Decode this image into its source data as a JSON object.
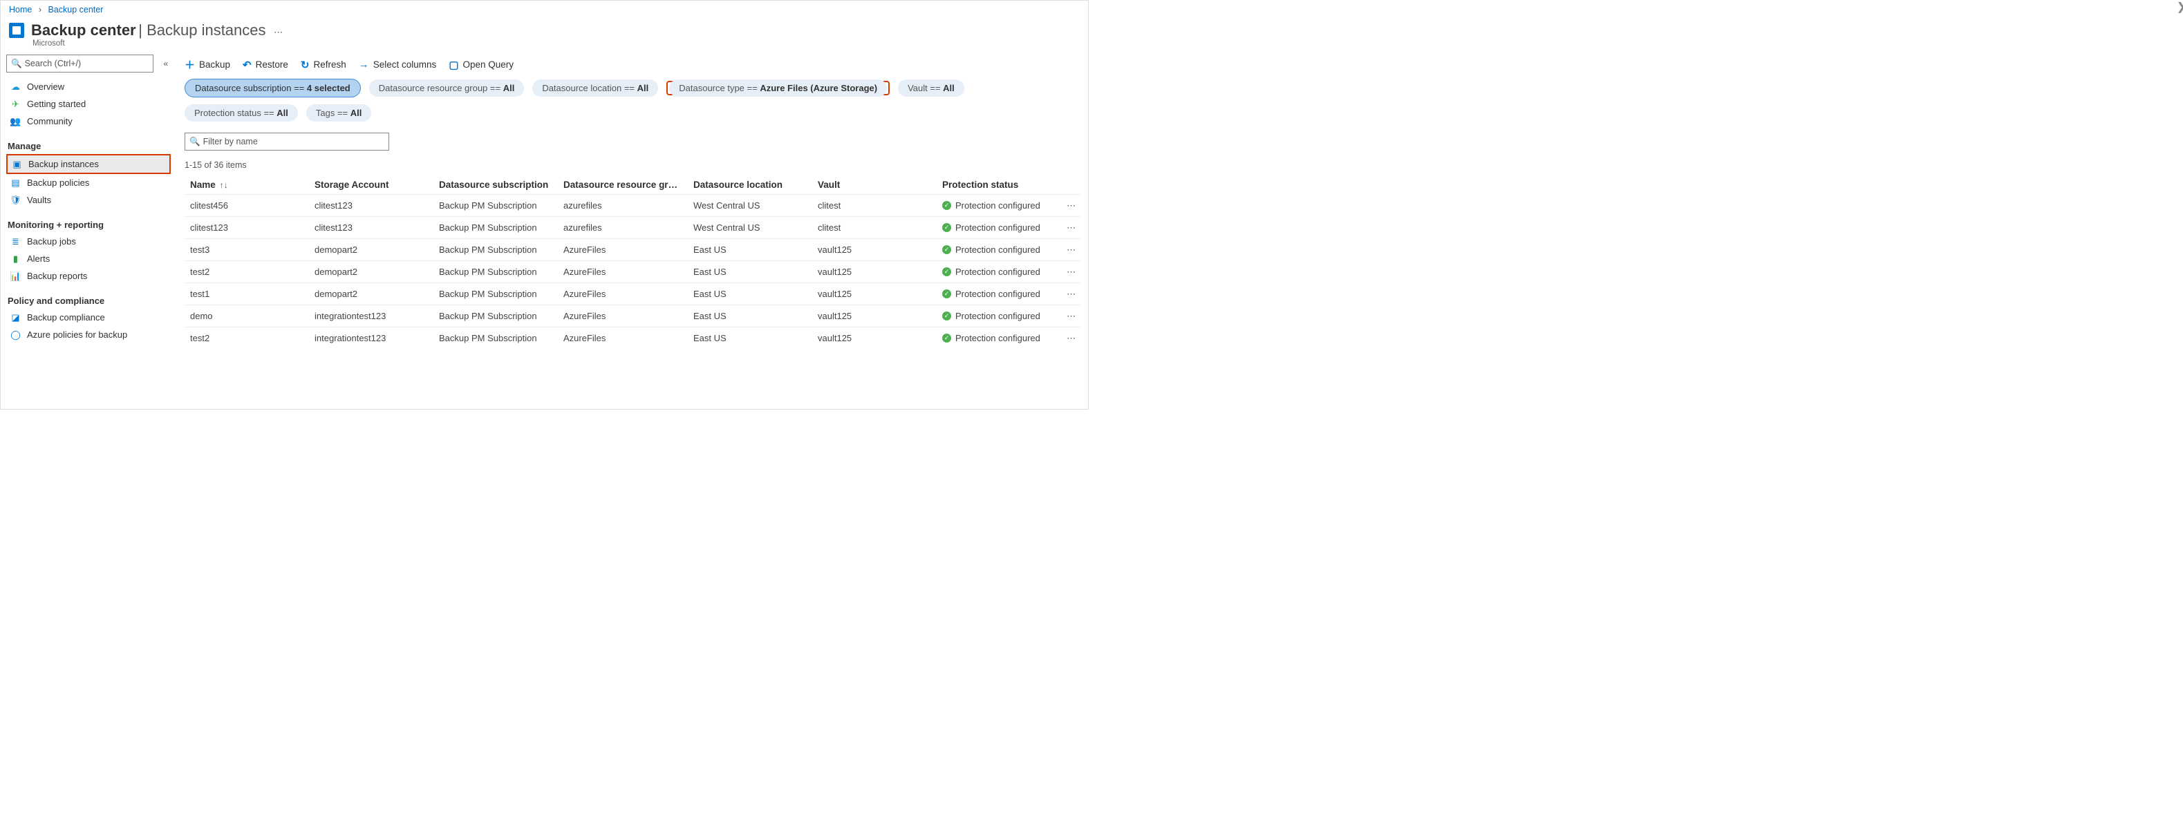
{
  "breadcrumb": {
    "home": "Home",
    "current": "Backup center"
  },
  "header": {
    "title": "Backup center",
    "subtitle": "Backup instances",
    "vendor": "Microsoft"
  },
  "sidebar": {
    "search_placeholder": "Search (Ctrl+/)",
    "items_top": [
      {
        "label": "Overview",
        "icon": "cloud"
      },
      {
        "label": "Getting started",
        "icon": "rocket"
      },
      {
        "label": "Community",
        "icon": "people"
      }
    ],
    "section_manage": "Manage",
    "items_manage": [
      {
        "label": "Backup instances",
        "icon": "instances",
        "active": true
      },
      {
        "label": "Backup policies",
        "icon": "policies"
      },
      {
        "label": "Vaults",
        "icon": "vaults"
      }
    ],
    "section_monitor": "Monitoring + reporting",
    "items_monitor": [
      {
        "label": "Backup jobs",
        "icon": "jobs"
      },
      {
        "label": "Alerts",
        "icon": "alerts"
      },
      {
        "label": "Backup reports",
        "icon": "reports"
      }
    ],
    "section_policy": "Policy and compliance",
    "items_policy": [
      {
        "label": "Backup compliance",
        "icon": "compliance"
      },
      {
        "label": "Azure policies for backup",
        "icon": "azurepolicies"
      }
    ]
  },
  "toolbar": {
    "backup": "Backup",
    "restore": "Restore",
    "refresh": "Refresh",
    "select_columns": "Select columns",
    "open_query": "Open Query"
  },
  "pills": {
    "subscription_prefix": "Datasource subscription == ",
    "subscription_value": "4 selected",
    "rg_prefix": "Datasource resource group == ",
    "rg_value": "All",
    "location_prefix": "Datasource location == ",
    "location_value": "All",
    "type_prefix": "Datasource type == ",
    "type_value": "Azure Files (Azure Storage)",
    "vault_prefix": "Vault == ",
    "vault_value": "All",
    "protection_prefix": "Protection status == ",
    "protection_value": "All",
    "tags_prefix": "Tags == ",
    "tags_value": "All"
  },
  "filter": {
    "placeholder": "Filter by name"
  },
  "count": "1-15 of 36 items",
  "columns": {
    "name": "Name",
    "storage": "Storage Account",
    "subscription": "Datasource subscription",
    "rg": "Datasource resource gr…",
    "location": "Datasource location",
    "vault": "Vault",
    "status": "Protection status"
  },
  "rows": [
    {
      "name": "clitest456",
      "storage": "clitest123",
      "subscription": "Backup PM Subscription",
      "rg": "azurefiles",
      "location": "West Central US",
      "vault": "clitest",
      "status": "Protection configured"
    },
    {
      "name": "clitest123",
      "storage": "clitest123",
      "subscription": "Backup PM Subscription",
      "rg": "azurefiles",
      "location": "West Central US",
      "vault": "clitest",
      "status": "Protection configured"
    },
    {
      "name": "test3",
      "storage": "demopart2",
      "subscription": "Backup PM Subscription",
      "rg": "AzureFiles",
      "location": "East US",
      "vault": "vault125",
      "status": "Protection configured"
    },
    {
      "name": "test2",
      "storage": "demopart2",
      "subscription": "Backup PM Subscription",
      "rg": "AzureFiles",
      "location": "East US",
      "vault": "vault125",
      "status": "Protection configured"
    },
    {
      "name": "test1",
      "storage": "demopart2",
      "subscription": "Backup PM Subscription",
      "rg": "AzureFiles",
      "location": "East US",
      "vault": "vault125",
      "status": "Protection configured"
    },
    {
      "name": "demo",
      "storage": "integrationtest123",
      "subscription": "Backup PM Subscription",
      "rg": "AzureFiles",
      "location": "East US",
      "vault": "vault125",
      "status": "Protection configured"
    },
    {
      "name": "test2",
      "storage": "integrationtest123",
      "subscription": "Backup PM Subscription",
      "rg": "AzureFiles",
      "location": "East US",
      "vault": "vault125",
      "status": "Protection configured"
    }
  ]
}
